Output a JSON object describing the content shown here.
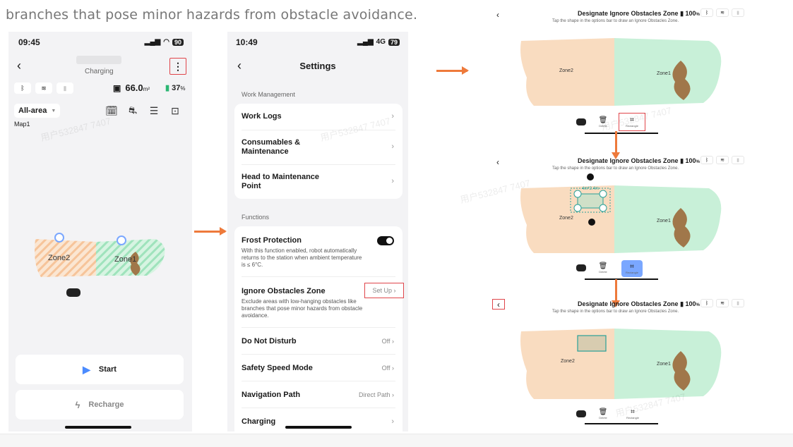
{
  "caption": "branches that pose minor hazards from obstacle avoidance.",
  "watermark": "用户532847 7407",
  "colors": {
    "accent_arrow": "#ee7a3b",
    "highlight_box": "#e0454a",
    "toggle_on": "#111111",
    "zone_orange": "#f9dcc0",
    "zone_green": "#c8f0d8",
    "tree": "#a0774a"
  },
  "phone1": {
    "time": "09:45",
    "signal_text": "90",
    "status": "Charging",
    "area_value": "66.0",
    "area_unit": "m²",
    "battery": "37",
    "battery_unit": "%",
    "area_select": "All-area",
    "map_name": "Map1",
    "zone_left": "Zone2",
    "zone_right": "Zone1",
    "start_label": "Start",
    "recharge_label": "Recharge",
    "icons": [
      "back-icon",
      "more-icon",
      "bluetooth-icon",
      "wifi-icon",
      "cellular-icon",
      "area-icon",
      "battery-icon",
      "schedule-icon",
      "mower-icon",
      "adjust-icon",
      "lock-icon",
      "play-icon",
      "lightning-icon"
    ]
  },
  "phone2": {
    "time": "10:49",
    "network": "4G",
    "battery": "79",
    "title": "Settings",
    "work_management_header": "Work Management",
    "work_logs": "Work Logs",
    "consumables": "Consumables & Maintenance",
    "head_to_maintenance": "Head to Maintenance Point",
    "functions_header": "Functions",
    "frost_title": "Frost Protection",
    "frost_desc": "With this function enabled, robot automatically returns to the station when ambient temperature is ≤ 6°C.",
    "frost_enabled": true,
    "ignore_title": "Ignore Obstacles Zone",
    "ignore_desc": "Exclude areas with low-hanging obstacles like branches that pose minor hazards from obstacle avoidance.",
    "setup_label": "Set Up",
    "dnd_title": "Do Not Disturb",
    "dnd_value": "Off",
    "safety_title": "Safety Speed Mode",
    "safety_value": "Off",
    "nav_title": "Navigation Path",
    "nav_value": "Direct Path",
    "charging_title": "Charging"
  },
  "panels": {
    "title": "Designate Ignore Obstacles Zone",
    "battery": "100",
    "battery_unit": "%",
    "subtitle": "Tap the shape in the options bar to draw an Ignore Obstacles Zone.",
    "zone_left": "Zone2",
    "zone_right": "Zone1",
    "delete_label": "Delete",
    "rectangle_label": "Rectangle",
    "dimension_label": "4m*2.4m"
  }
}
